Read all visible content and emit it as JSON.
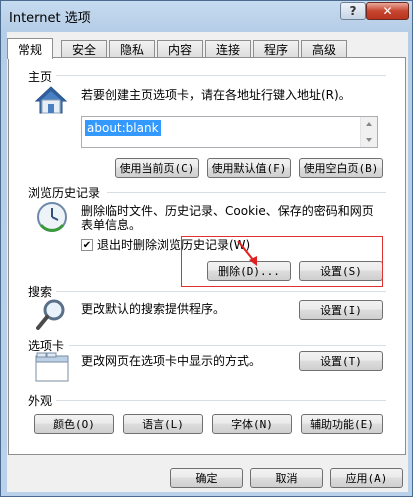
{
  "window": {
    "title": "Internet 选项",
    "help": "?",
    "close": "✕"
  },
  "tabs": [
    "常规",
    "安全",
    "隐私",
    "内容",
    "连接",
    "程序",
    "高级"
  ],
  "homepage": {
    "section": "主页",
    "description": "若要创建主页选项卡，请在各地址行键入地址(R)。",
    "value": "about:blank",
    "buttons": [
      "使用当前页(C)",
      "使用默认值(F)",
      "使用空白页(B)"
    ]
  },
  "history": {
    "section": "浏览历史记录",
    "description_line1": "删除临时文件、历史记录、Cookie、保存的密码和网页",
    "description_line2": "表单信息。",
    "checkbox_label": "退出时删除浏览历史记录(W)",
    "checked": true,
    "delete_button": "删除(D)...",
    "settings_button": "设置(S)"
  },
  "search": {
    "section": "搜索",
    "description": "更改默认的搜索提供程序。",
    "settings_button": "设置(I)"
  },
  "tabs_section": {
    "section": "选项卡",
    "description": "更改网页在选项卡中显示的方式。",
    "settings_button": "设置(T)"
  },
  "appearance": {
    "section": "外观",
    "buttons": [
      "颜色(O)",
      "语言(L)",
      "字体(N)",
      "辅助功能(E)"
    ]
  },
  "footer": {
    "ok": "确定",
    "cancel": "取消",
    "apply": "应用(A)"
  }
}
